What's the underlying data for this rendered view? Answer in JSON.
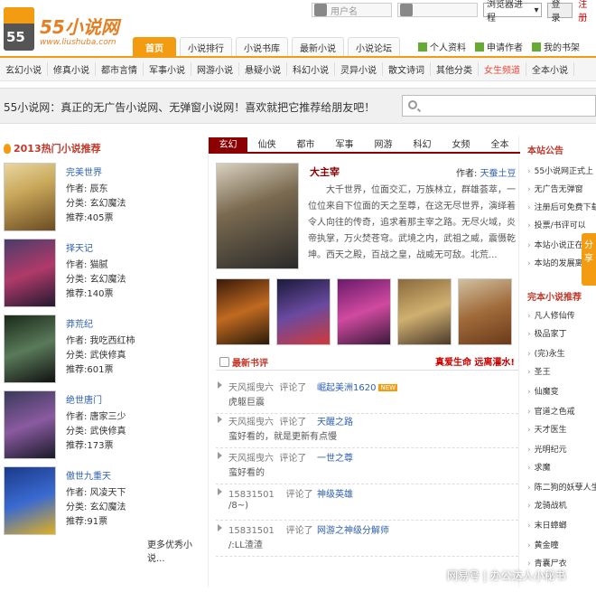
{
  "header": {
    "logo_title": "55小说网",
    "logo_url": "www.liushuba.com",
    "logo_num": "55",
    "username_placeholder": "用户名",
    "dropdown_value": "浏览器进程",
    "login_label": "登录",
    "register_label": "注册"
  },
  "nav": {
    "tabs": [
      "首页",
      "小说排行",
      "小说书库",
      "最新小说",
      "小说论坛"
    ],
    "user_links": [
      "个人资料",
      "申请作者",
      "我的书架"
    ]
  },
  "categories": [
    "玄幻小说",
    "修真小说",
    "都市言情",
    "军事小说",
    "网游小说",
    "悬疑小说",
    "科幻小说",
    "灵异小说",
    "散文诗词",
    "其他分类",
    "女生频道",
    "全本小说"
  ],
  "slogan": "55小说网：真正的无广告小说网、无弹窗小说网！喜欢就把它推荐给朋友吧！",
  "left": {
    "title": "2013热门小说推荐",
    "books": [
      {
        "title": "完美世界",
        "author": "作者: 辰东",
        "category": "分类: 玄幻魔法",
        "votes": "推荐:405票"
      },
      {
        "title": "择天记",
        "author": "作者: 猫腻",
        "category": "分类: 玄幻魔法",
        "votes": "推荐:140票"
      },
      {
        "title": "莽荒纪",
        "author": "作者: 我吃西红柿",
        "category": "分类: 武侠修真",
        "votes": "推荐:601票"
      },
      {
        "title": "绝世唐门",
        "author": "作者: 唐家三少",
        "category": "分类: 武侠修真",
        "votes": "推荐:173票"
      },
      {
        "title": "傲世九重天",
        "author": "作者: 风凌天下",
        "category": "分类: 玄幻魔法",
        "votes": "推荐:91票"
      }
    ],
    "more": "更多优秀小说..."
  },
  "mid": {
    "tabs": [
      "玄幻",
      "仙侠",
      "都市",
      "军事",
      "网游",
      "科幻",
      "女频",
      "全本"
    ],
    "featured": {
      "title": "大主宰",
      "author_label": "作者:",
      "author": "天蚕土豆",
      "desc": "大千世界，位面交汇，万族林立，群雄荟萃，一位位来自下位面的天之至尊，在这无尽世界，演绎着令人向往的传奇，追求着那主宰之路。无尽火域，炎帝执掌，万火焚苍穹。武境之内，武祖之威，震慑乾坤。西天之殿，百战之皇，战威无可敌。北荒..."
    },
    "review_title": "最新书评",
    "review_slogan": "真爱生命 远离灌水!",
    "reviews": [
      {
        "user": "天风摇曳六",
        "action": "评论了",
        "book": "崛起美洲1620",
        "comment": "虎躯巨震",
        "new": "NEW"
      },
      {
        "user": "天风摇曳六",
        "action": "评论了",
        "book": "天醒之路",
        "comment": "蛮好看的，就是更新有点慢",
        "new": ""
      },
      {
        "user": "天风摇曳六",
        "action": "评论了",
        "book": "一世之尊",
        "comment": "蛮好看的",
        "new": ""
      },
      {
        "user": "15831501",
        "action": "评论了",
        "book": "神级英雄",
        "comment": "/8~)",
        "new": ""
      },
      {
        "user": "15831501",
        "action": "评论了",
        "book": "网游之神级分解师",
        "comment": "/:LL渣渣",
        "new": ""
      }
    ]
  },
  "right": {
    "notice_title": "本站公告",
    "notices": [
      "55小说网正式上",
      "无广告无弹窗",
      "注册后可免费下载",
      "投票/书评可以",
      "本站小说正在",
      "本站的发展离"
    ],
    "share": "分享",
    "complete_title": "完本小说推荐",
    "complete": [
      "凡人修仙传",
      "极品家丁",
      "(完)永生",
      "圣王",
      "仙魔变",
      "官道之色戒",
      "天才医生",
      "光明纪元",
      "求魔",
      "陈二狗的妖孽人生",
      "龙骑战机",
      "末日蟑螂",
      "黄金瞳",
      "青囊尸衣"
    ]
  },
  "watermark": "网易号 | 办公达人小秘书",
  "colors": {
    "accent": "#f39c12",
    "brand_red": "#8b0000",
    "link_blue": "#2e5fb3"
  }
}
